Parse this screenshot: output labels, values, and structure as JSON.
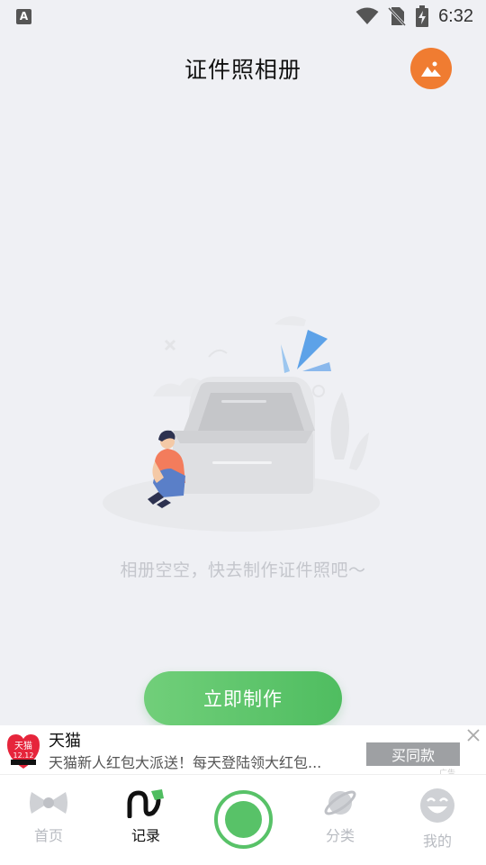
{
  "status_bar": {
    "time": "6:32",
    "keyboard_indicator": "A",
    "icons": [
      "wifi-icon",
      "no-sim-icon",
      "battery-charging-icon"
    ]
  },
  "header": {
    "title": "证件照相册",
    "gallery_icon": "image-icon",
    "accent_color": "#f07c31"
  },
  "empty_state": {
    "message": "相册空空，快去制作证件照吧～"
  },
  "cta": {
    "label": "立即制作",
    "color": "#5ec46c"
  },
  "ad": {
    "brand_logo_text": "天猫",
    "brand_logo_subtext": "12.12",
    "title": "天猫",
    "description": "天猫新人红包大派送！每天登陆领大红包...",
    "action_label": "买同款",
    "tag": "广告"
  },
  "bottom_nav": {
    "items": [
      {
        "label": "首页",
        "icon": "bow-icon",
        "active": false
      },
      {
        "label": "记录",
        "icon": "record-icon",
        "active": true
      },
      {
        "label": "分类",
        "icon": "planet-icon",
        "active": false
      },
      {
        "label": "我的",
        "icon": "smiley-icon",
        "active": false
      }
    ],
    "capture_color": "#58c268"
  }
}
